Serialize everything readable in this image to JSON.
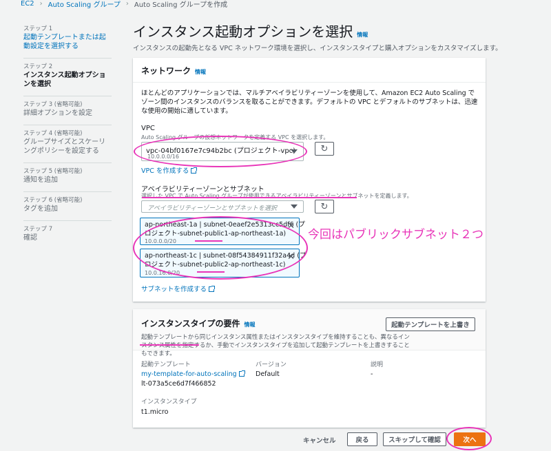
{
  "breadcrumb": {
    "items": [
      "EC2",
      "Auto Scaling グループ",
      "Auto Scaling グループを作成"
    ]
  },
  "steps": [
    {
      "label": "ステップ 1",
      "title": "起動テンプレートまたは起動設定を選択する",
      "state": "done"
    },
    {
      "label": "ステップ 2",
      "title": "インスタンス起動オプションを選択",
      "state": "current"
    },
    {
      "label": "ステップ 3 (省略可能)",
      "title": "詳細オプションを設定",
      "state": "todo"
    },
    {
      "label": "ステップ 4 (省略可能)",
      "title": "グループサイズとスケーリングポリシーを設定する",
      "state": "todo"
    },
    {
      "label": "ステップ 5 (省略可能)",
      "title": "通知を追加",
      "state": "todo"
    },
    {
      "label": "ステップ 6 (省略可能)",
      "title": "タグを追加",
      "state": "todo"
    },
    {
      "label": "ステップ 7",
      "title": "確認",
      "state": "todo"
    }
  ],
  "page": {
    "title": "インスタンス起動オプションを選択",
    "info": "情報",
    "subtitle": "インスタンスの起動先となる VPC ネットワーク環境を選択し、インスタンスタイプと購入オプションをカスタマイズします。"
  },
  "network": {
    "title": "ネットワーク",
    "info": "情報",
    "description": "ほとんどのアプリケーションでは、マルチアベイラビリティーゾーンを使用して、Amazon EC2 Auto Scaling でゾーン間のインスタンスのバランスを取ることができます。デフォルトの VPC とデフォルトのサブネットは、迅速な使用の開始に適しています。",
    "vpc_label": "VPC",
    "vpc_help": "Auto Scaling グループの仮想ネットワークを定義する VPC を選択します。",
    "vpc_value": "vpc-04bf0167e7c94b2bc (プロジェクト-vpc)",
    "vpc_cidr": "10.0.0.0/16",
    "vpc_create_link": "VPC を作成する",
    "az_label": "アベイラビリティーゾーンとサブネット",
    "az_help": "選択した VPC で Auto Scaling グループが使用できるアベイラビリティーゾーンとサブネットを定義します。",
    "az_placeholder": "アベイラビリティーゾーンとサブネットを選択",
    "subnets": [
      {
        "line1": "ap-northeast-1a | subnet-0eaef2e5313cc5df6 (プ",
        "line2": "ロジェクト-subnet-public1-ap-northeast-1a)",
        "cidr": "10.0.0.0/20"
      },
      {
        "line1": "ap-northeast-1c | subnet-08f54384911f32a4d (プ",
        "line2": "ロジェクト-subnet-public2-ap-northeast-1c)",
        "cidr": "10.0.16.0/20"
      }
    ],
    "subnet_create_link": "サブネットを作成する"
  },
  "annotation": "今回はパブリックサブネット２つ",
  "instance_type": {
    "title": "インスタンスタイプの要件",
    "info": "情報",
    "override_button": "起動テンプレートを上書き",
    "description": "起動テンプレートから同じインスタンス属性またはインスタンスタイプを維持することも、異なるインスタンス属性を指定するか、手動でインスタンスタイプを追加して起動テンプレートを上書きすることもできます。",
    "template_label": "起動テンプレート",
    "template_value": "my-template-for-auto-scaling",
    "template_id": "lt-073a5ce6d7f466852",
    "version_label": "バージョン",
    "version_value": "Default",
    "desc_label": "説明",
    "desc_value": "-",
    "itype_label": "インスタンスタイプ",
    "itype_value": "t1.micro"
  },
  "footer": {
    "cancel": "キャンセル",
    "back": "戻る",
    "skip": "スキップして確認",
    "next": "次へ"
  },
  "colors": {
    "accent": "#ec7211",
    "link": "#0073bb",
    "annotation": "#e834b8"
  }
}
